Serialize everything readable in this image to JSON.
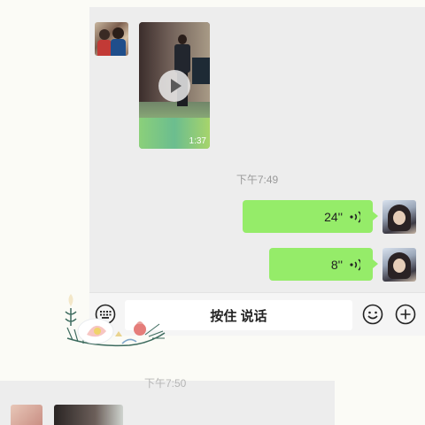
{
  "chat": {
    "video": {
      "duration": "1:37",
      "icon": "play-icon"
    },
    "timestamp": "下午7:49",
    "voice_messages": [
      {
        "duration": "24''",
        "icon": "voice-wave-icon"
      },
      {
        "duration": "8''",
        "icon": "voice-wave-icon"
      }
    ]
  },
  "input_bar": {
    "hold_to_talk_label": "按住 说话",
    "icons": [
      "keyboard-icon",
      "emoji-icon",
      "plus-icon"
    ]
  },
  "bottom_panel": {
    "timestamp": "下午7:50"
  },
  "colors": {
    "chat_background": "#ededed",
    "bubble_green": "#95ec69",
    "page_background": "#fbfbf6"
  }
}
